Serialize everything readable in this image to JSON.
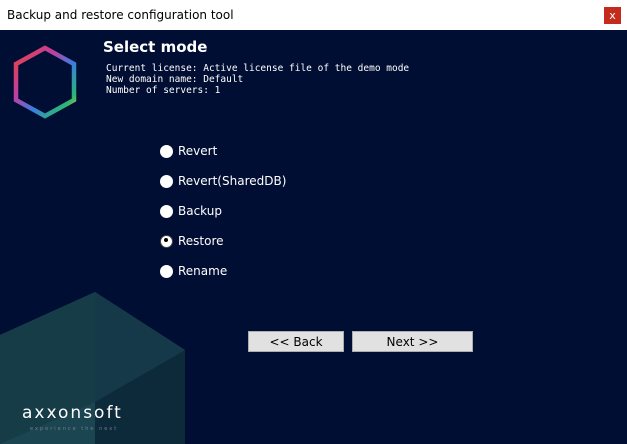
{
  "window": {
    "title": "Backup and restore configuration tool",
    "close_label": "x"
  },
  "header": {
    "title": "Select mode",
    "license_line": "Current license: Active license file of the demo mode",
    "domain_line": "New domain name: Default",
    "servers_line": "Number of servers: 1"
  },
  "modes": [
    {
      "label": "Revert",
      "selected": false
    },
    {
      "label": "Revert(SharedDB)",
      "selected": false
    },
    {
      "label": "Backup",
      "selected": false
    },
    {
      "label": "Restore",
      "selected": true
    },
    {
      "label": "Rename",
      "selected": false
    }
  ],
  "buttons": {
    "back": "<< Back",
    "next": "Next >>"
  },
  "brand": {
    "name": "axxonsoft",
    "tagline": "experience the next"
  },
  "colors": {
    "background": "#000e33",
    "deco_light": "#1b4550",
    "deco_dark": "#0d2a3a",
    "close": "#c42b1c"
  },
  "icons": {
    "logo": "hexagon-gradient-logo"
  }
}
